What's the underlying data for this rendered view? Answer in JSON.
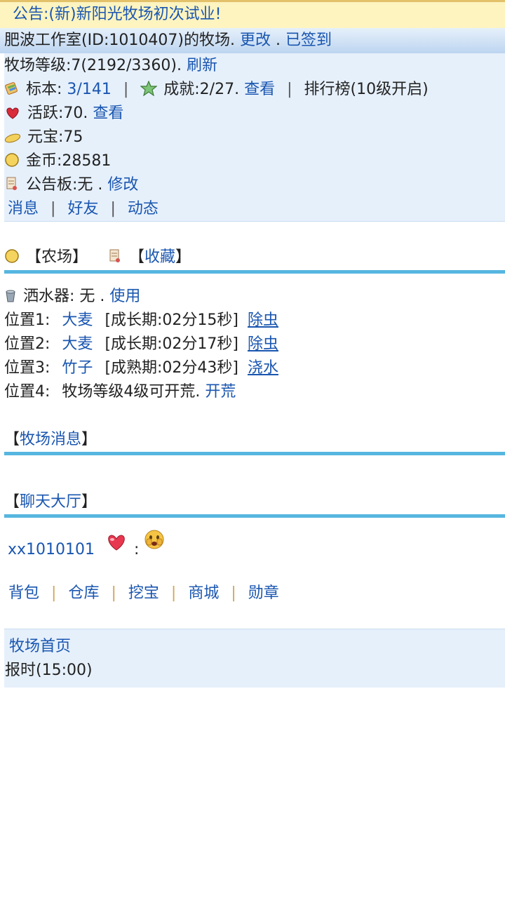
{
  "notice": {
    "text": "公告:(新)新阳光牧场初次试业!"
  },
  "header": {
    "owner_text": "肥波工作室(ID:1010407)的牧场.",
    "change_link": "更改",
    "dot": ".",
    "signed_link": "已签到"
  },
  "info": {
    "level_text": "牧场等级:7(2192/3360).",
    "refresh_link": "刷新",
    "specimen_label": "标本:",
    "specimen_value": "3/141",
    "achievement_text": "成就:2/27.",
    "achievement_view": "查看",
    "ranking_text": "排行榜(10级开启)",
    "activity_text": "活跃:70.",
    "activity_view": "查看",
    "yuanbao_text": "元宝:75",
    "gold_text": "金币:28581",
    "board_text": "公告板:无 .",
    "board_edit": "修改",
    "nav": [
      "消息",
      "好友",
      "动态"
    ]
  },
  "sections": {
    "farm_label": "【农场】",
    "collection_open": "【",
    "collection_link": "收藏",
    "collection_close": "】",
    "ranch_msg_link": "牧场消息",
    "chat_link": "聊天大厅"
  },
  "sprinkler": {
    "text": "洒水器: 无 .",
    "use_link": "使用"
  },
  "plots": [
    {
      "pos": "位置1:",
      "crop": "大麦",
      "status": "[成长期:02分15秒]",
      "action": "除虫"
    },
    {
      "pos": "位置2:",
      "crop": "大麦",
      "status": "[成长期:02分17秒]",
      "action": "除虫"
    },
    {
      "pos": "位置3:",
      "crop": "竹子",
      "status": "[成熟期:02分43秒]",
      "action": "浇水"
    }
  ],
  "plot4": {
    "pos": "位置4:",
    "text": "牧场等级4级可开荒.",
    "action": "开荒"
  },
  "chat": {
    "user": "xx1010101",
    "colon": ":"
  },
  "footer_links": [
    "背包",
    "仓库",
    "挖宝",
    "商城",
    "勋章"
  ],
  "home": {
    "link": "牧场首页",
    "time": "报时(15:00)"
  },
  "icons": {
    "specimen": "specimen-icon",
    "achievement": "star-icon",
    "activity": "heart-icon",
    "yuanbao": "ingot-icon",
    "gold": "gold-coin-icon",
    "board": "scroll-icon",
    "sprinkler": "sprinkler-icon"
  }
}
